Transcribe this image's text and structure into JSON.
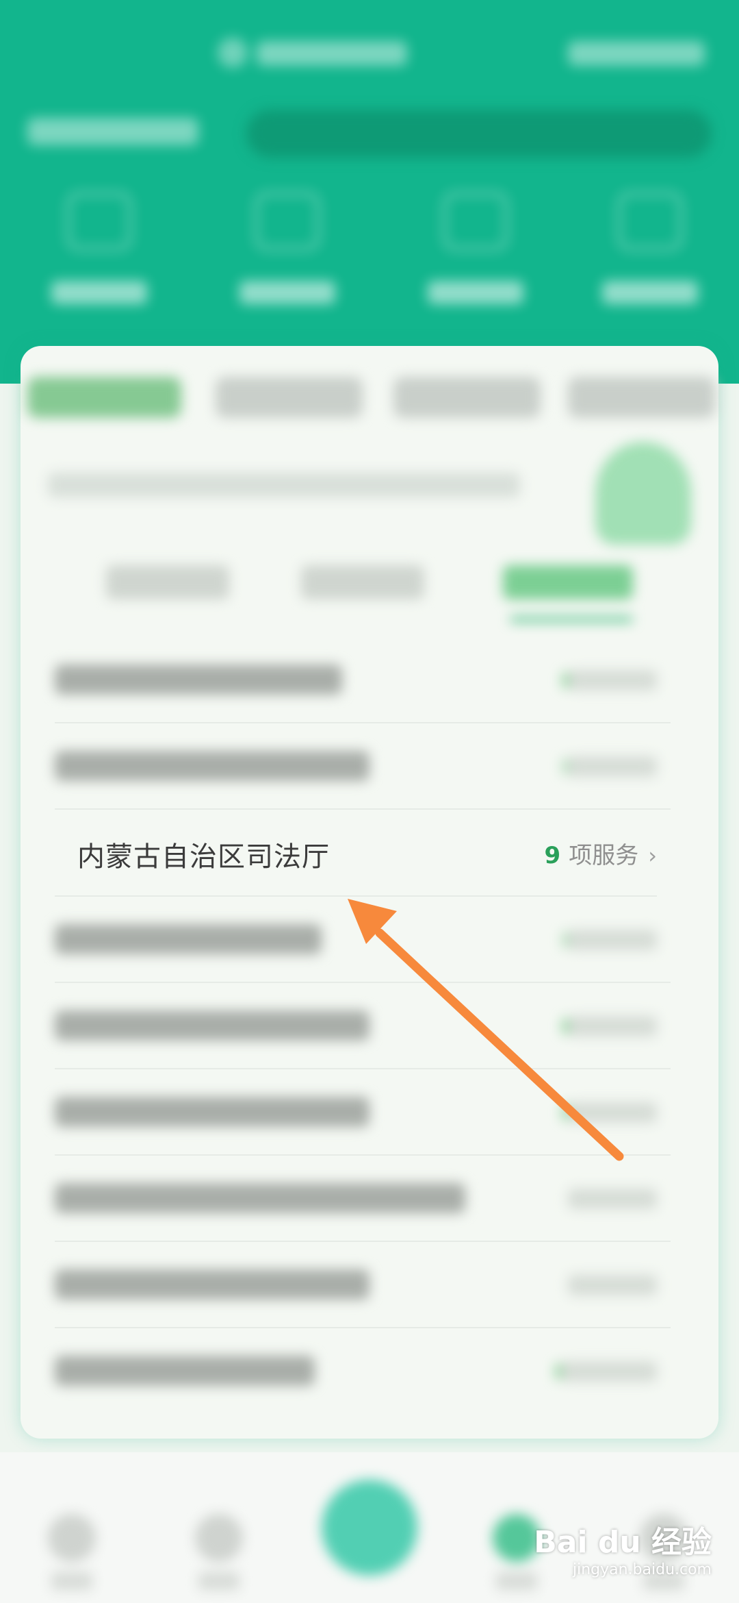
{
  "focused_item": {
    "title": "内蒙古自治区司法厅",
    "count": "9",
    "suffix": "项服务",
    "chevron": "›"
  },
  "watermark": {
    "main": "Bai du 经验",
    "sub": "jingyan.baidu.com"
  },
  "colors": {
    "header": "#12b58d",
    "accent_green": "#2aa05a",
    "arrow": "#f7893c"
  },
  "icons": {
    "chevron": "chevron-right-icon",
    "arrow": "annotation-arrow"
  }
}
